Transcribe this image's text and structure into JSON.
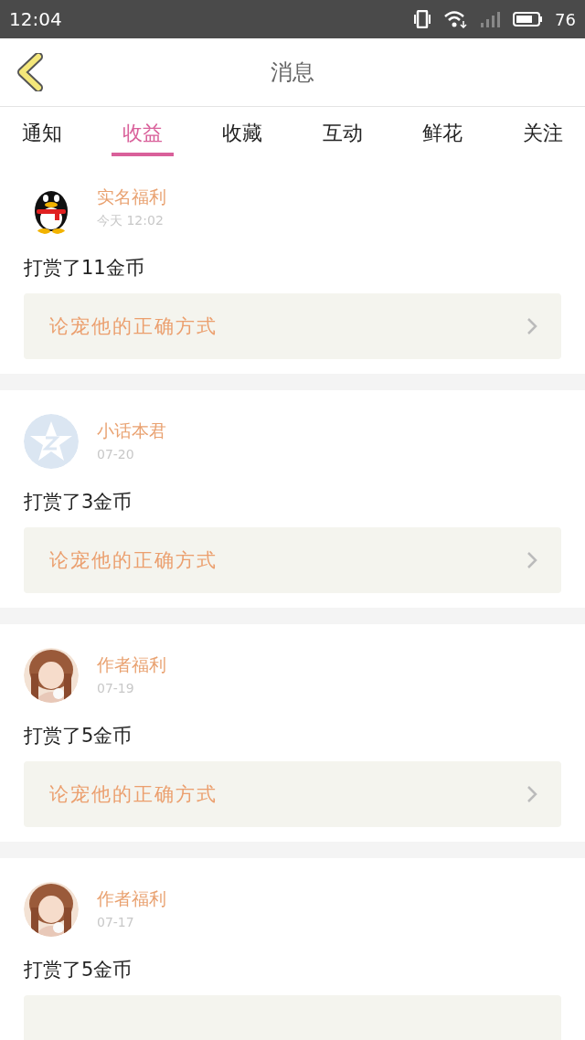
{
  "status_bar": {
    "time": "12:04",
    "battery": "76"
  },
  "header": {
    "title": "消息"
  },
  "tabs": [
    {
      "label": "通知",
      "selected": false
    },
    {
      "label": "收益",
      "selected": true
    },
    {
      "label": "收藏",
      "selected": false
    },
    {
      "label": "互动",
      "selected": false
    },
    {
      "label": "鲜花",
      "selected": false
    },
    {
      "label": "关注",
      "selected": false
    }
  ],
  "messages": [
    {
      "avatar": {
        "kind": "penguin"
      },
      "name": "实名福利",
      "time": "今天 12:02",
      "text": "打赏了11金币",
      "link": "论宠他的正确方式"
    },
    {
      "avatar": {
        "kind": "star"
      },
      "name": "小话本君",
      "time": "07-20",
      "text": "打赏了3金币",
      "link": "论宠他的正确方式"
    },
    {
      "name": "作者福利",
      "time": "07-19",
      "text": "打赏了5金币",
      "link": "论宠他的正确方式"
    },
    {
      "name": "作者福利",
      "time": "07-17",
      "text": "打赏了5金币"
    }
  ]
}
